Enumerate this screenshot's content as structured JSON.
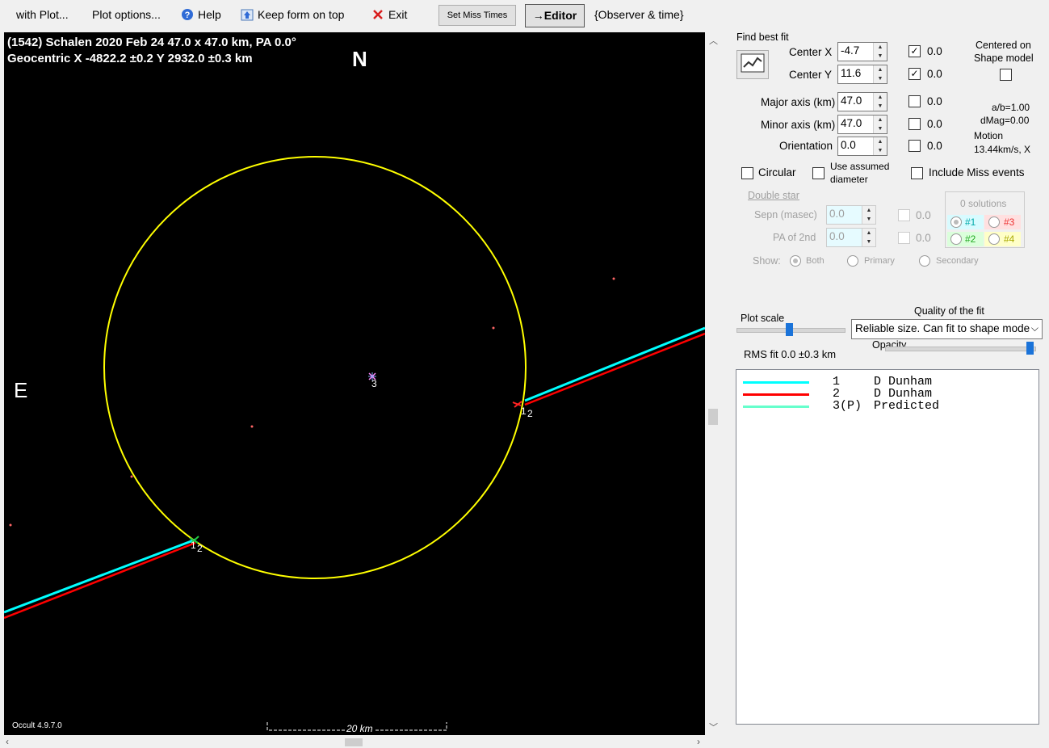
{
  "menu": {
    "with_plot": "with Plot...",
    "plot_options": "Plot options...",
    "help": "Help",
    "keep_on_top": "Keep form on top",
    "exit": "Exit",
    "set_miss_times": "Set Miss Times",
    "editor": "→Editor",
    "observer_time": "{Observer & time}"
  },
  "plot": {
    "title_line1": "(1542) Schalen  2020 Feb 24  47.0 x 47.0 km, PA 0.0°",
    "title_line2": "Geocentric  X  -4822.2 ±0.2  Y 2932.0 ±0.3 km",
    "north": "N",
    "east": "E",
    "version": "Occult 4.9.7.0",
    "scale_label": "20 km",
    "chord_labels": {
      "c1": "1",
      "c2": "2",
      "c3": "3"
    },
    "colors": {
      "background": "#000000",
      "ellipse": "#ffff00",
      "chord1": "#00ffff",
      "chord2": "#ff0000",
      "predicted": "#66ffcc",
      "points": "#ff6666"
    }
  },
  "panel": {
    "find_best_fit": "Find best fit",
    "center_x_label": "Center X",
    "center_x_value": "-4.7",
    "center_y_label": "Center Y",
    "center_y_value": "11.6",
    "major_label": "Major axis (km)",
    "major_value": "47.0",
    "minor_label": "Minor axis (km)",
    "minor_value": "47.0",
    "orientation_label": "Orientation",
    "orientation_value": "0.0",
    "fit_vals": [
      "0.0",
      "0.0",
      "0.0",
      "0.0",
      "0.0"
    ],
    "centered_on_shape_1": "Centered on",
    "centered_on_shape_2": "Shape model",
    "ab_ratio": "a/b=1.00",
    "dmag": "dMag=0.00",
    "motion_label": "Motion",
    "motion_value": "13.44km/s, X",
    "circular": "Circular",
    "use_assumed_1": "Use assumed",
    "use_assumed_2": "diameter",
    "include_miss": "Include Miss events",
    "double_star": "Double star",
    "sepn_label": "Sepn (masec)",
    "sepn_value": "0.0",
    "pa2_label": "PA of 2nd",
    "pa2_value": "0.0",
    "ds_vals": [
      "0.0",
      "0.0"
    ],
    "solutions": "0 solutions",
    "sol1": "#1",
    "sol2": "#2",
    "sol3": "#3",
    "sol4": "#4",
    "show_label": "Show:",
    "show_both": "Both",
    "show_primary": "Primary",
    "show_secondary": "Secondary",
    "plot_scale": "Plot scale",
    "quality_label": "Quality of the fit",
    "quality_value": "Reliable size. Can fit to shape mode",
    "opacity": "Opacity",
    "rms_fit": "RMS fit  0.0 ±0.3 km",
    "plot_scale_level": 0.5,
    "opacity_level": 1.0
  },
  "legend": [
    {
      "num": "1",
      "observer": "D Dunham",
      "color": "#00ffff"
    },
    {
      "num": "2",
      "observer": "D Dunham",
      "color": "#ff0000"
    },
    {
      "num": "3(P)",
      "observer": "Predicted",
      "color": "#66ffcc"
    }
  ]
}
